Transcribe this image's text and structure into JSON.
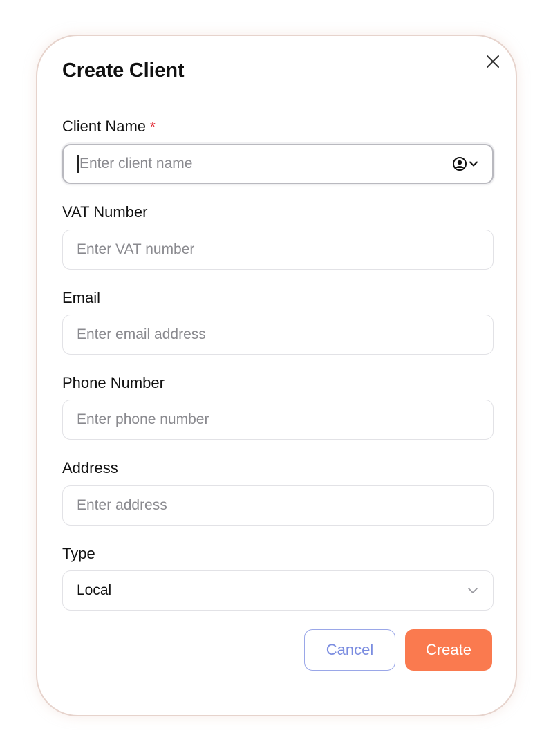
{
  "modal": {
    "title": "Create Client",
    "close_icon": "close-icon"
  },
  "fields": {
    "client_name": {
      "label": "Client Name",
      "required_mark": "*",
      "placeholder": "Enter client name",
      "value": "",
      "autofill_icon": "user-circle-icon"
    },
    "vat_number": {
      "label": "VAT Number",
      "placeholder": "Enter VAT number",
      "value": ""
    },
    "email": {
      "label": "Email",
      "placeholder": "Enter email address",
      "value": ""
    },
    "phone_number": {
      "label": "Phone Number",
      "placeholder": "Enter phone number",
      "value": ""
    },
    "address": {
      "label": "Address",
      "placeholder": "Enter address",
      "value": ""
    },
    "type": {
      "label": "Type",
      "selected": "Local"
    }
  },
  "actions": {
    "cancel_label": "Cancel",
    "create_label": "Create"
  },
  "colors": {
    "accent": "#fa7a4f",
    "cancel_border": "#9aa7e8",
    "cancel_text": "#7a8ce0",
    "required": "#e0242f"
  }
}
